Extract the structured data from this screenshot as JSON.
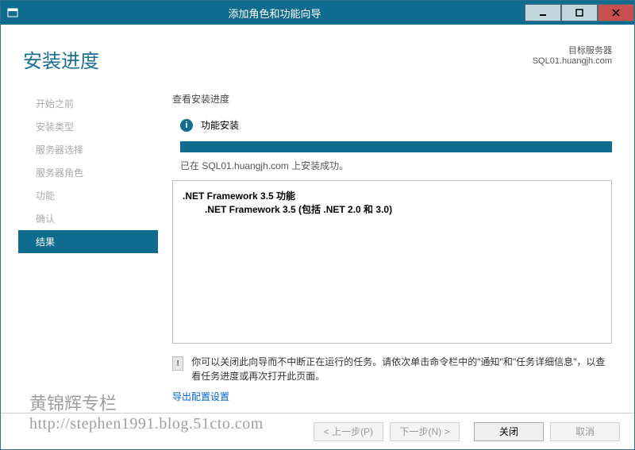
{
  "window": {
    "title": "添加角色和功能向导"
  },
  "header": {
    "title": "安装进度",
    "target_label": "目标服务器",
    "target_server": "SQL01.huangjh.com"
  },
  "sidebar": {
    "items": [
      {
        "label": "开始之前",
        "active": false
      },
      {
        "label": "安装类型",
        "active": false
      },
      {
        "label": "服务器选择",
        "active": false
      },
      {
        "label": "服务器角色",
        "active": false
      },
      {
        "label": "功能",
        "active": false
      },
      {
        "label": "确认",
        "active": false
      },
      {
        "label": "结果",
        "active": true
      }
    ]
  },
  "main": {
    "section_title": "查看安装进度",
    "status_label": "功能安装",
    "status_message": "已在 SQL01.huangjh.com 上安装成功。",
    "features": {
      "parent": ".NET Framework 3.5 功能",
      "child": ".NET Framework 3.5 (包括 .NET 2.0 和 3.0)"
    },
    "notice": "你可以关闭此向导而不中断正在运行的任务。请依次单击命令栏中的\"通知\"和\"任务详细信息\"，以查看任务进度或再次打开此页面。",
    "export_link": "导出配置设置"
  },
  "footer": {
    "prev": "< 上一步(P)",
    "next": "下一步(N) >",
    "close": "关闭",
    "cancel": "取消"
  },
  "watermark": {
    "line1": "黄锦辉专栏",
    "line2": "http://stephen1991.blog.51cto.com"
  }
}
